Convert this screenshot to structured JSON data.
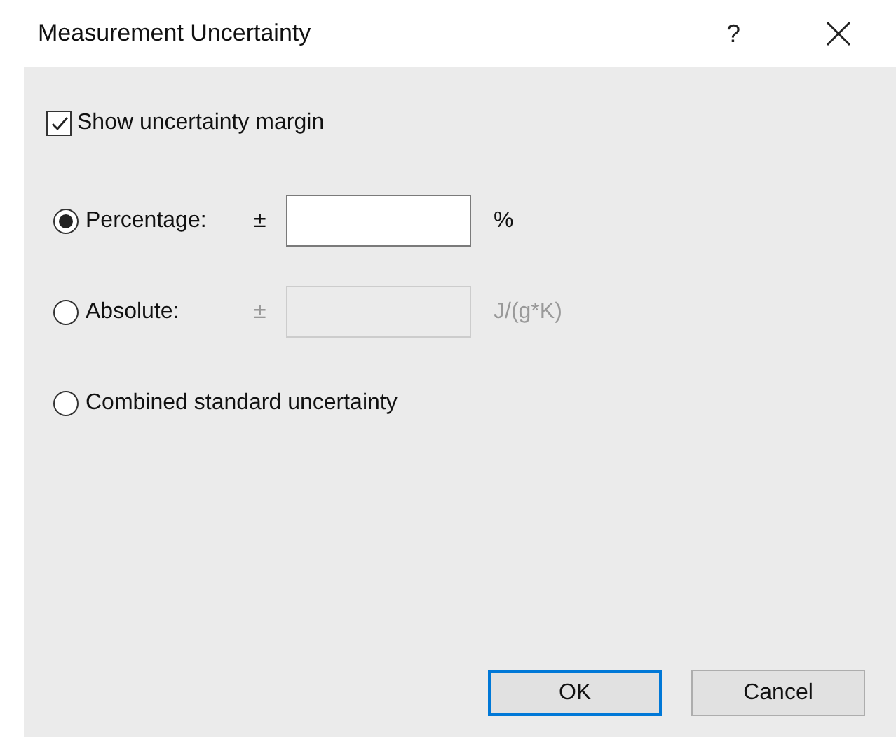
{
  "window": {
    "title": "Measurement Uncertainty",
    "help_button": "?"
  },
  "show_margin": {
    "label": "Show uncertainty margin",
    "checked": true
  },
  "options": [
    {
      "kind": "field",
      "label": "Percentage:",
      "selected": true,
      "sign": "±",
      "unit": "%",
      "field_disabled": false
    },
    {
      "kind": "field",
      "label": "Absolute:",
      "selected": false,
      "sign": "±",
      "unit": "J/(g*K)",
      "field_disabled": true
    },
    {
      "kind": "plain",
      "label": "Combined standard uncertainty",
      "selected": false
    }
  ],
  "buttons": [
    {
      "label": "OK",
      "default": true
    },
    {
      "label": "Cancel",
      "default": false
    }
  ]
}
